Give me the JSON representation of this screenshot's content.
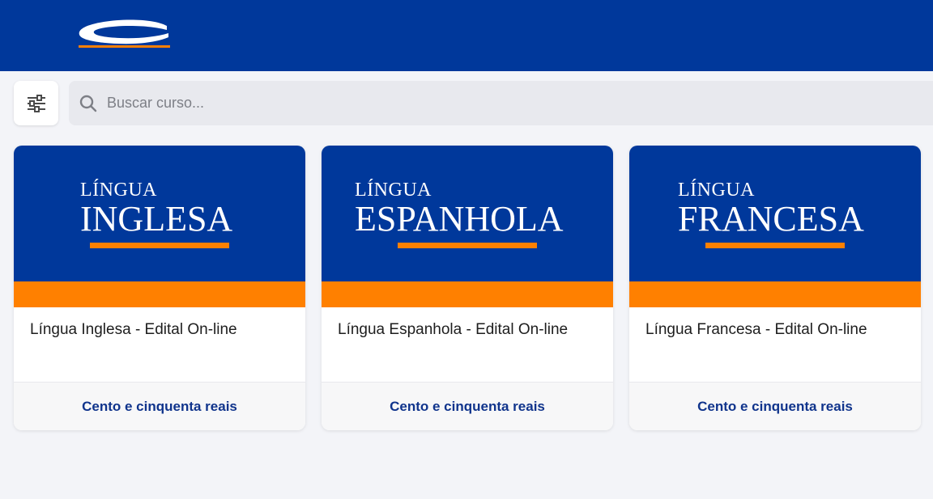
{
  "search": {
    "placeholder": "Buscar curso..."
  },
  "courses": [
    {
      "banner_kicker": "LÍNGUA",
      "banner_title": "INGLESA",
      "title": "Língua Inglesa - Edital On-line",
      "price": "Cento e cinquenta reais"
    },
    {
      "banner_kicker": "LÍNGUA",
      "banner_title": "ESPANHOLA",
      "title": "Língua Espanhola - Edital On-line",
      "price": "Cento e cinquenta reais"
    },
    {
      "banner_kicker": "LÍNGUA",
      "banner_title": "FRANCESA",
      "title": "Língua Francesa - Edital On-line",
      "price": "Cento e cinquenta reais"
    }
  ],
  "colors": {
    "brand_blue": "#00389b",
    "accent_orange": "#ff8000",
    "price_text": "#10348c"
  },
  "icons": {
    "logo": "logo-icon",
    "filter": "sliders-icon",
    "search": "search-icon"
  }
}
